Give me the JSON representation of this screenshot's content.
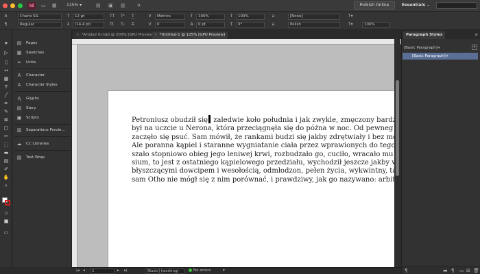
{
  "app_bar": {
    "logo": "Id",
    "zoom": "125%",
    "publish_label": "Publish Online",
    "workspace_label": "Essentials",
    "workspace_chevron": "⌄",
    "search_placeholder": "",
    "icons": [
      "bridge-icon",
      "layout-icon",
      "screen-mode-icon",
      "share-icon"
    ]
  },
  "control_panel": {
    "font_family": "Charis SIL",
    "font_style": "Regular",
    "font_size": "12 pt",
    "leading": "(14,4 pt)",
    "kerning": "Metrics",
    "tracking": "0",
    "horizontal_scale": "100%",
    "vertical_scale": "100%",
    "baseline_shift": "0 pt",
    "skew": "0°",
    "char_style": "[None]",
    "language": "Polish",
    "color_percent": "100%"
  },
  "dock": {
    "items": [
      {
        "icon": "pages-icon",
        "label": "Pages"
      },
      {
        "icon": "swatches-icon",
        "label": "Swatches"
      },
      {
        "icon": "links-icon",
        "label": "Links"
      },
      {
        "icon": "character-icon",
        "label": "Character"
      },
      {
        "icon": "character-styles-icon",
        "label": "Character Styles"
      },
      {
        "icon": "glyphs-icon",
        "label": "Glyphs"
      },
      {
        "icon": "story-icon",
        "label": "Story"
      },
      {
        "icon": "scripts-icon",
        "label": "Scripts"
      },
      {
        "icon": "separations-icon",
        "label": "Separations Previe..."
      },
      {
        "icon": "cc-libraries-icon",
        "label": "CC Libraries"
      },
      {
        "icon": "text-wrap-icon",
        "label": "Text Wrap"
      }
    ]
  },
  "tabs": [
    {
      "label": "*Artykuł 9.indd @ 200% [GPU Preview]",
      "active": false
    },
    {
      "label": "*Untitled-1 @ 125% [GPU Preview]",
      "active": true
    }
  ],
  "document": {
    "lines": [
      {
        "before": "Petroniusz obudził się",
        "after": " zaledwie koło południa i jak zwykle, zmęczony bardz"
      },
      {
        "text": "był na uczcie u Nerona, która przeciągnęła się do późna w noc. Od pewneg"
      },
      {
        "text": "zaczęło się psuć. Sam mówił, że rankami budzi się jakby zdrętwiały i bez moż"
      },
      {
        "text": "Ale poranna kąpiel i staranne wygniatanie ciała przez wprawionych do tego n"
      },
      {
        "text": "szało stopniowo obieg jego leniwej krwi, rozbudzało go, cuciło, wracało mu s"
      },
      {
        "text": "sium, to jest z ostatniego kąpielowego przedziału, wychodził jeszcze jakby wsk"
      },
      {
        "text": "błyszczącymi dowcipem i wesołością, odmłodzon, pełen życia, wykwintny, ta"
      },
      {
        "text": "sam Otho nie mógł się z nim porównać, i prawdziwy, jak go nazywano: arbit"
      }
    ]
  },
  "status_bar": {
    "page": "1",
    "style": "[Basic] (working)",
    "errors": "No errors"
  },
  "right_panel": {
    "title": "Paragraph Styles",
    "current_style": "[Basic Paragraph]+",
    "styles": [
      "[Basic Paragraph]+"
    ]
  }
}
